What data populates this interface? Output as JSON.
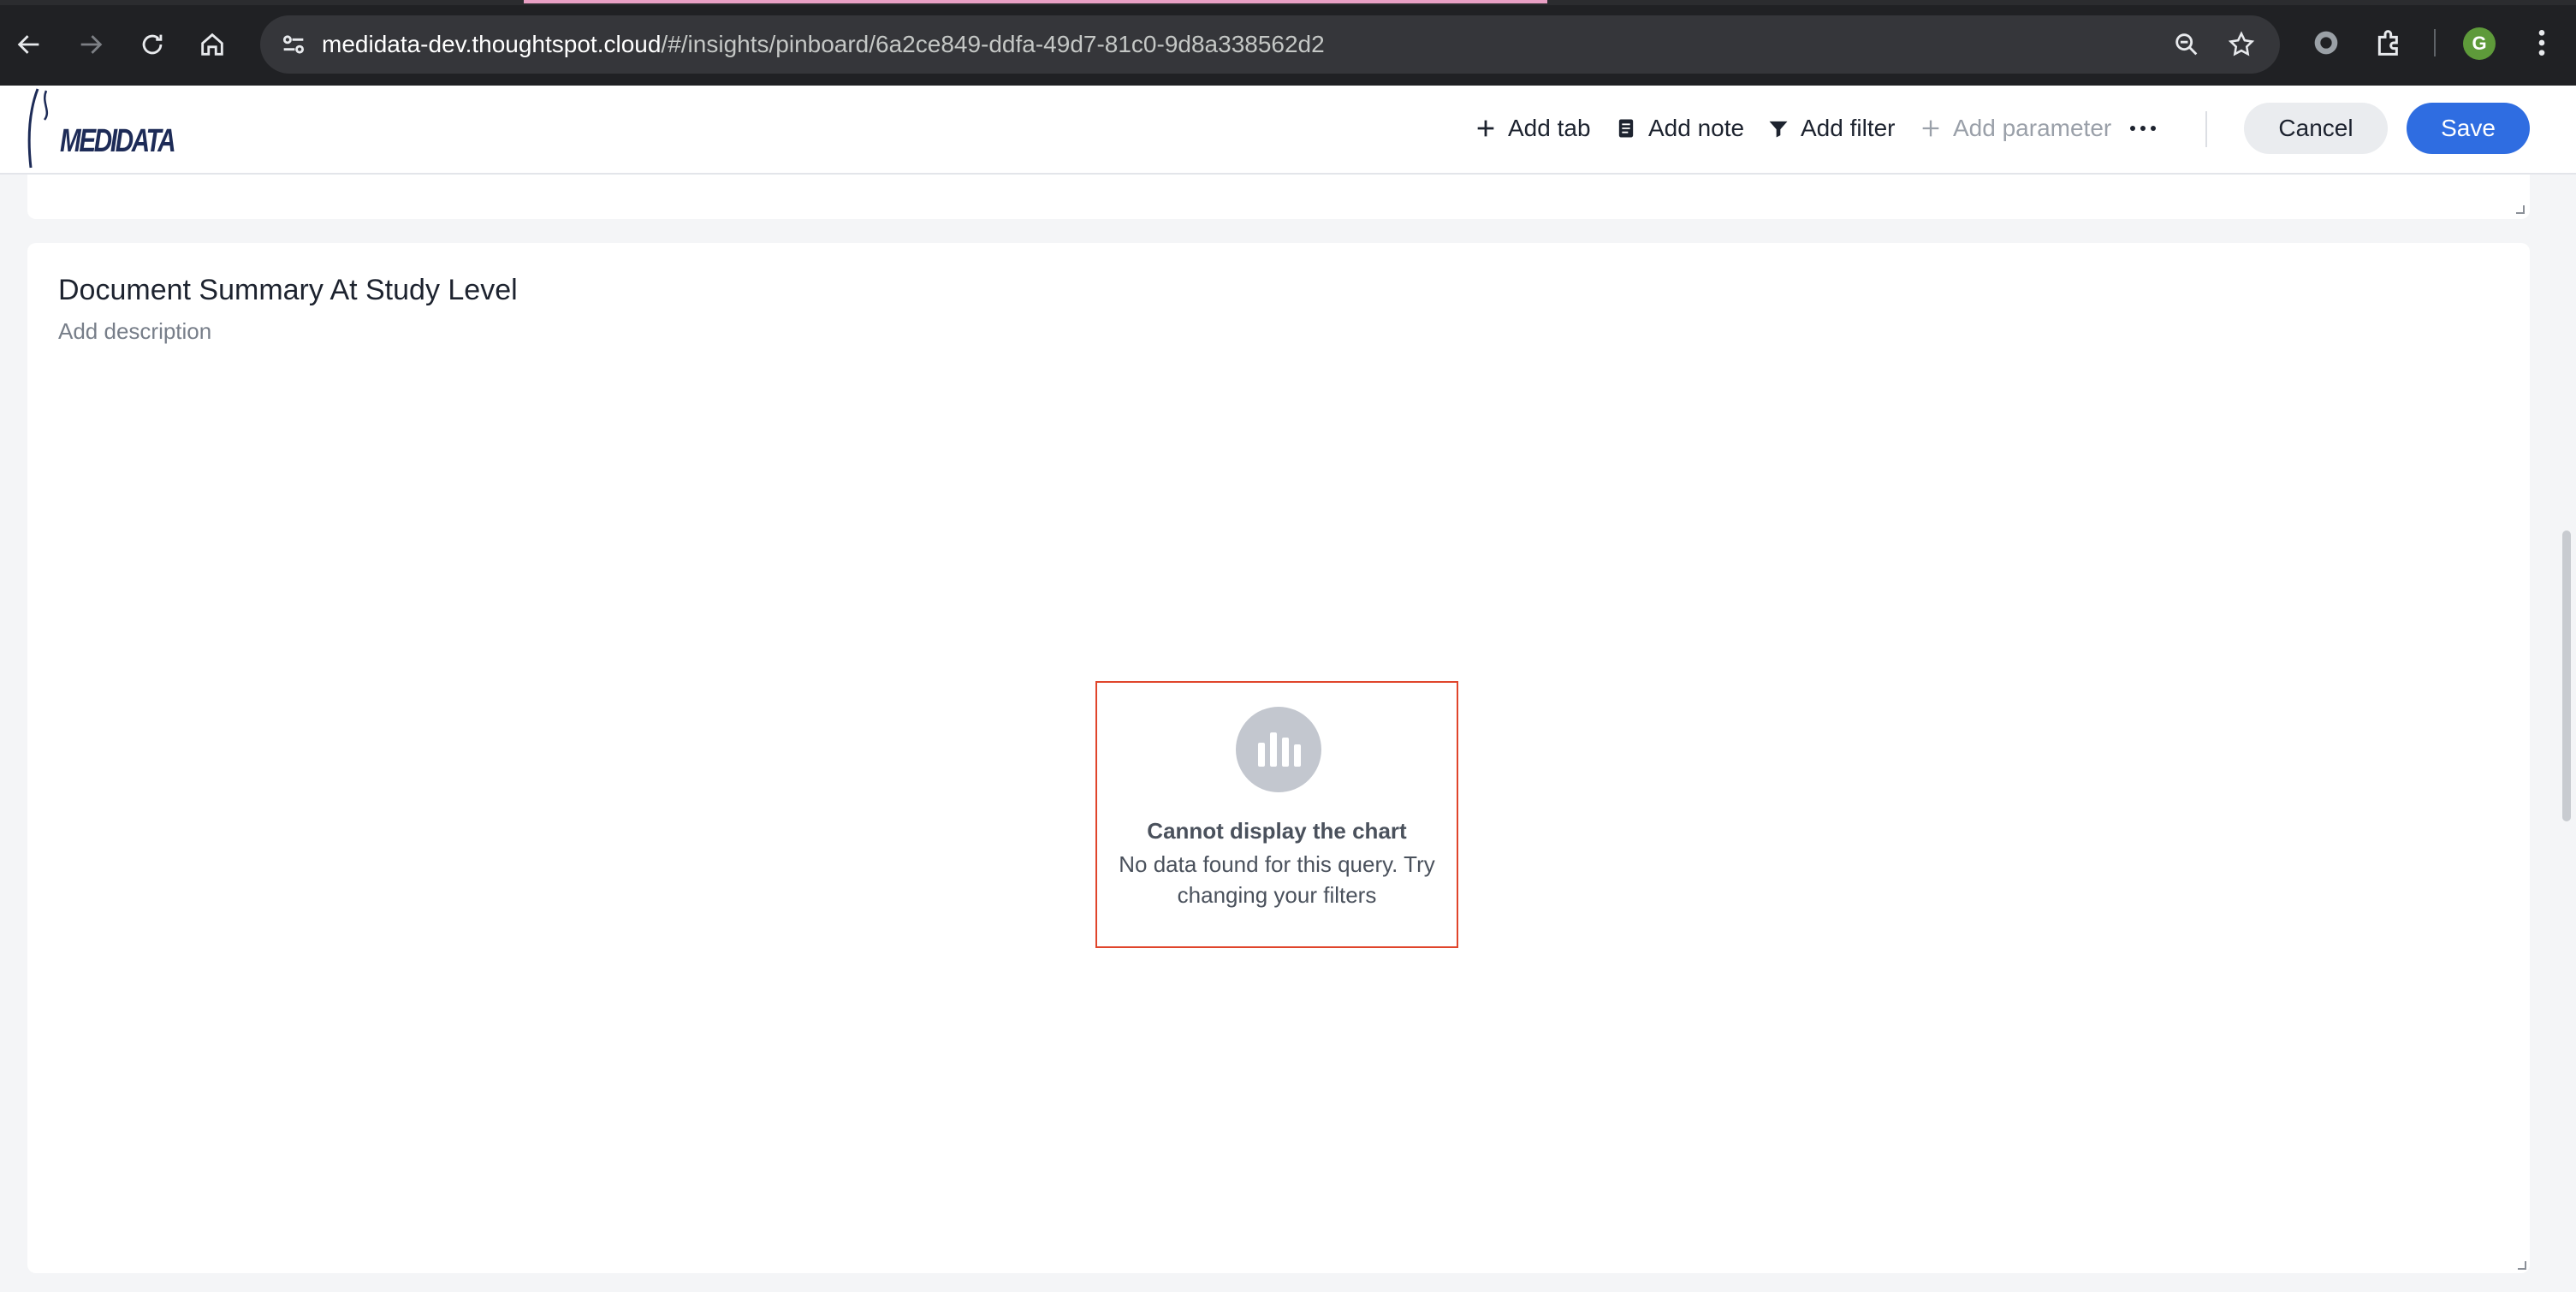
{
  "browser": {
    "url_host": "medidata-dev.thoughtspot.cloud",
    "url_path": "/#/insights/pinboard/6a2ce849-ddfa-49d7-81c0-9d8a338562d2",
    "profile_initial": "G",
    "icons": {
      "back": "back-arrow-icon",
      "forward": "forward-arrow-icon",
      "reload": "reload-icon",
      "home": "home-icon",
      "site_info": "site-settings-icon",
      "zoom": "zoom-icon",
      "bookmark": "star-icon",
      "extension": "extension-puzzle-icon",
      "menu": "kebab-menu-icon"
    }
  },
  "header": {
    "logo_text": "MEDIDATA",
    "add_tab_label": "Add tab",
    "add_note_label": "Add note",
    "add_filter_label": "Add filter",
    "add_parameter_label": "Add parameter",
    "cancel_label": "Cancel",
    "save_label": "Save",
    "colors": {
      "accent": "#2f6de1",
      "text": "#1d232f",
      "disabled": "#9aa0a9"
    }
  },
  "card": {
    "title": "Document Summary At Study Level",
    "description_placeholder": "Add description",
    "empty_state": {
      "title": "Cannot display the chart",
      "message": "No data found for this query. Try changing your filters",
      "icon": "bar-chart-icon",
      "highlight_color": "#e0452b"
    }
  }
}
